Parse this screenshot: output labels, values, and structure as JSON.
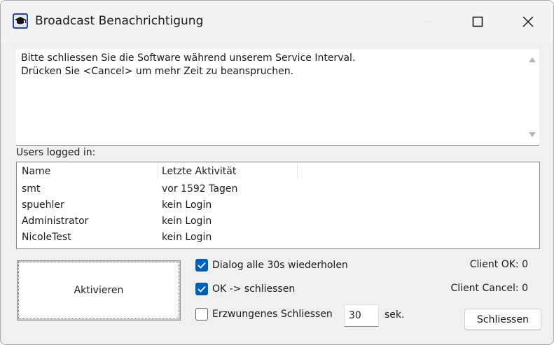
{
  "window": {
    "title": "Broadcast Benachrichtigung"
  },
  "message": {
    "text": "Bitte schliessen Sie die Software während unserem Service Interval.\nDrücken Sie <Cancel> um mehr Zeit zu beanspruchen."
  },
  "users": {
    "label": "Users logged in:",
    "columns": [
      "Name",
      "Letzte Aktivität"
    ],
    "rows": [
      {
        "name": "smt",
        "activity": "vor 1592 Tagen"
      },
      {
        "name": "spuehler",
        "activity": "kein Login"
      },
      {
        "name": "Administrator",
        "activity": "kein Login"
      },
      {
        "name": "NicoleTest",
        "activity": "kein Login"
      }
    ]
  },
  "actions": {
    "activate_label": "Aktivieren",
    "repeat_label": "Dialog alle 30s wiederholen",
    "repeat_checked": true,
    "ok_close_label": "OK -> schliessen",
    "ok_close_checked": true,
    "forced_label": "Erzwungenes Schliessen",
    "forced_checked": false,
    "seconds_value": "30",
    "seconds_unit": "sek.",
    "close_label": "Schliessen"
  },
  "stats": {
    "client_ok": "Client OK: 0",
    "client_cancel": "Client Cancel: 0"
  },
  "colors": {
    "accent": "#005fb8",
    "window_bg": "#f0f0f0"
  },
  "icons": {
    "app": "graduation-cap-icon",
    "minimize": "minimize-icon",
    "maximize": "maximize-icon",
    "close": "close-icon"
  }
}
